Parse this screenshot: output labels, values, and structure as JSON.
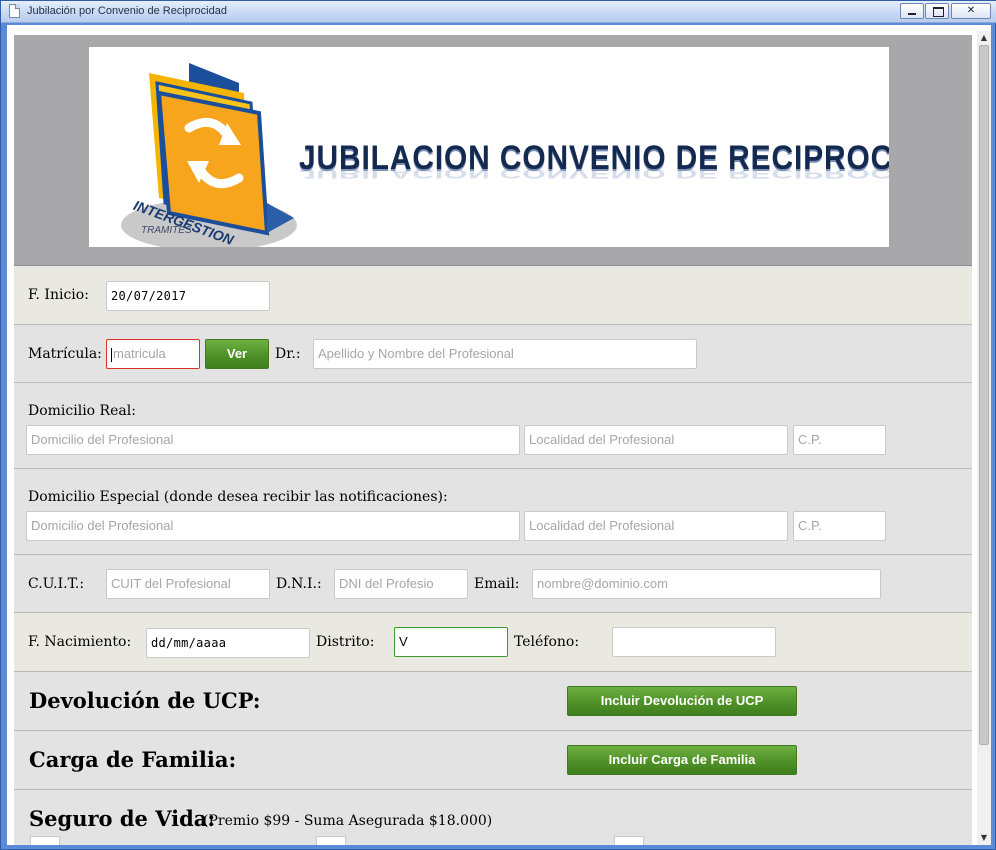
{
  "window": {
    "title": "Jubilación por Convenio de Reciprocidad"
  },
  "banner": {
    "title": "JUBILACION CONVENIO DE RECIPROCIDAD",
    "logo_text_1": "INTERGESTION",
    "logo_text_2": "TRAMITES"
  },
  "form": {
    "inicio": {
      "label": "F. Inicio:",
      "value": "20/07/2017"
    },
    "matricula": {
      "label": "Matrícula:",
      "placeholder": "matricula",
      "button": "Ver",
      "dr_label": "Dr.:",
      "dr_placeholder": "Apellido y Nombre del Profesional"
    },
    "domicilio_real": {
      "label": "Domicilio Real:",
      "domicilio_placeholder": "Domicilio del Profesional",
      "localidad_placeholder": "Localidad del Profesional",
      "cp_placeholder": "C.P."
    },
    "domicilio_especial": {
      "label": "Domicilio Especial (donde desea recibir las notificaciones):",
      "domicilio_placeholder": "Domicilio del Profesional",
      "localidad_placeholder": "Localidad del Profesional",
      "cp_placeholder": "C.P."
    },
    "cuit": {
      "label": "C.U.I.T.:",
      "placeholder": "CUIT del Profesional"
    },
    "dni": {
      "label": "D.N.I.:",
      "placeholder": "DNI del Profesio"
    },
    "email": {
      "label": "Email:",
      "placeholder": "nombre@dominio.com"
    },
    "nacimiento": {
      "label": "F. Nacimiento:",
      "value": "dd/mm/aaaa"
    },
    "distrito": {
      "label": "Distrito:",
      "value": "V"
    },
    "telefono": {
      "label": "Teléfono:",
      "value": ""
    },
    "devolucion": {
      "label": "Devolución de UCP:",
      "button": "Incluir Devolución de UCP"
    },
    "carga_familia": {
      "label": "Carga de Familia:",
      "button": "Incluir Carga de Familia"
    },
    "seguro_vida": {
      "label": "Seguro de Vida:",
      "detail": "(Premio $99 - Suma Asegurada $18.000)"
    }
  },
  "colors": {
    "button_green": "#4f9128",
    "error_border": "#d8322a",
    "ok_border": "#3c9a2e",
    "banner_navy": "#13294f"
  }
}
